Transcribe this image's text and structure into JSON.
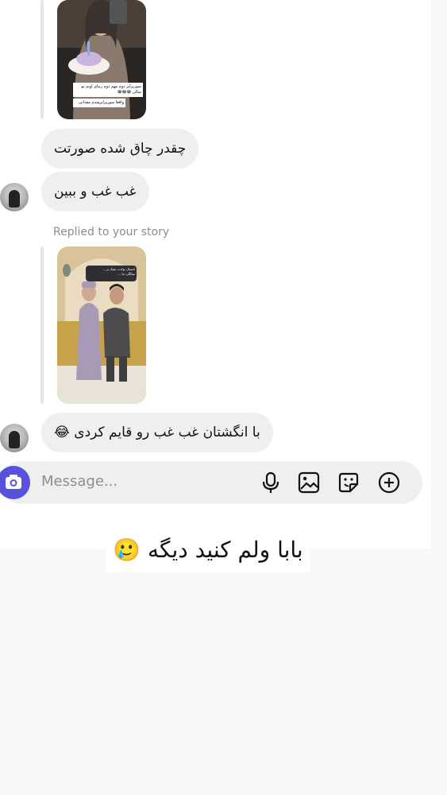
{
  "messages": [
    {
      "text": "چقدر چاق شده صورتت"
    },
    {
      "text": "غب غب و ببین"
    },
    {
      "text": "با انگشتان غب غب رو قایم کردی 😂"
    }
  ],
  "reply_notice": "Replied to your story",
  "story_1": {
    "caption_line_1": "سورپرایز دوم مهم دوم زیبای اونم تو",
    "caption_line_2": "سالن 😂😂😂",
    "caption_line_3": "واقعا سورپرایزشدم مقدایی"
  },
  "story_2": {
    "caption_line_1": "امسال تولدت شیک تر...",
    "caption_line_2": "سالگرد ما ..."
  },
  "composer": {
    "placeholder": "Message...",
    "icons": [
      "camera-icon",
      "microphone-icon",
      "gallery-icon",
      "sticker-icon",
      "plus-icon"
    ]
  },
  "overlay_caption": "بابا ولم کنید دیگه 🥲",
  "colors": {
    "accent": "#5851db",
    "bubble": "#efeff0"
  }
}
